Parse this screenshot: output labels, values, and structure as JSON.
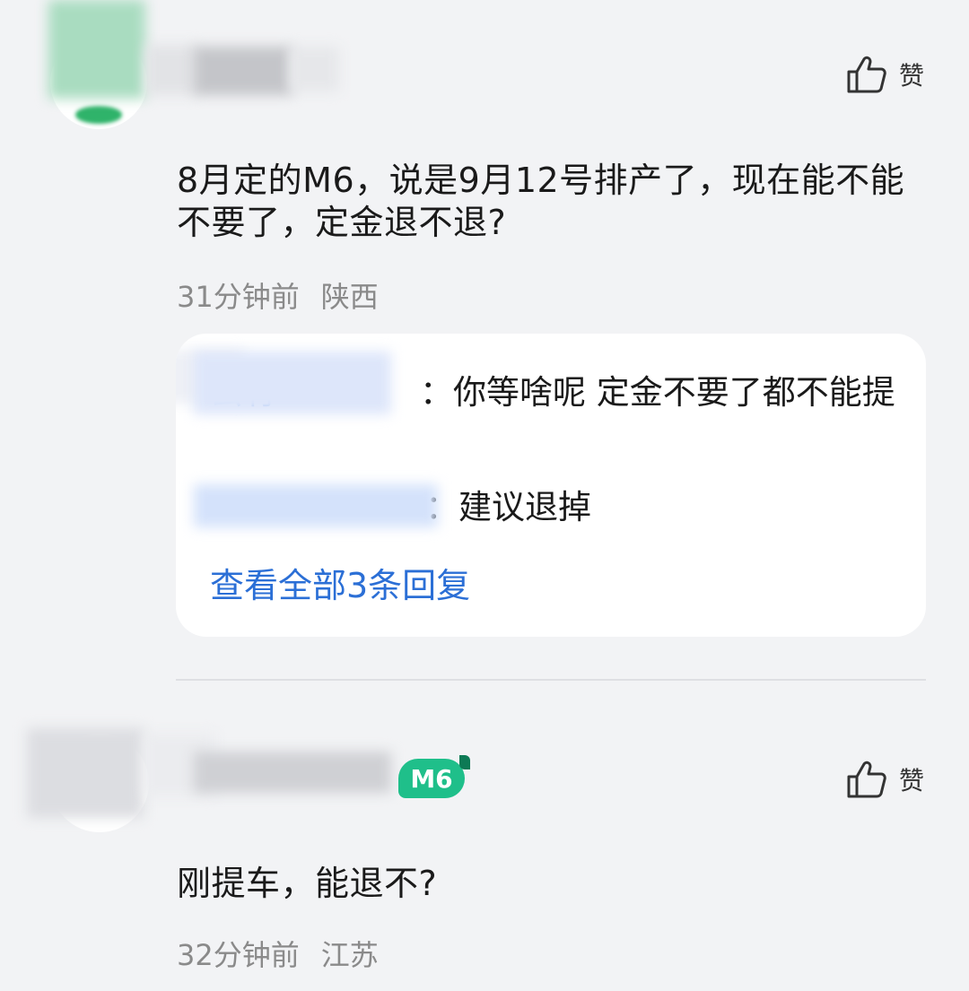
{
  "comments": [
    {
      "like_label": "赞",
      "text": "8月定的M6，说是9月12号排产了，现在能不能不要了，定金退不退?",
      "time": "31分钟前",
      "location": "陕西",
      "replies": [
        {
          "author": "云有",
          "text": "：你等啥呢  定金不要了都不能提"
        },
        {
          "author": "",
          "text": "：建议退掉"
        }
      ],
      "see_all": "查看全部3条回复"
    },
    {
      "like_label": "赞",
      "badge": "M6",
      "text": "刚提车，能退不?",
      "time": "32分钟前",
      "location": "江苏"
    }
  ],
  "colors": {
    "background": "#f2f3f5",
    "link": "#2b6fd6",
    "badge": "#1fbf8a",
    "meta": "#8a8a8a"
  }
}
